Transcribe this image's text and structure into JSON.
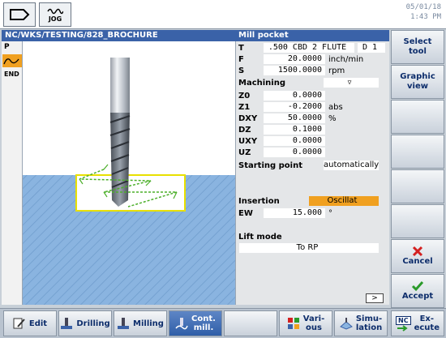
{
  "header": {
    "back_icon": "back-arrow-icon",
    "jog_label": "JOG",
    "date": "05/01/18",
    "time": "1:43 PM"
  },
  "path": "NC/WKS/TESTING/828_BROCHURE",
  "panel_title": "Mill pocket",
  "left_strip": {
    "p_label": "P",
    "end_label": "END"
  },
  "params": {
    "t": {
      "label": "T",
      "value": ".500 CBD 2 FLUTE",
      "extra": "D 1"
    },
    "f": {
      "label": "F",
      "value": "20.0000",
      "unit": "inch/min"
    },
    "s": {
      "label": "S",
      "value": "1500.0000",
      "unit": "rpm"
    },
    "machining": {
      "label": "Machining",
      "value": "▽"
    },
    "z0": {
      "label": "Z0",
      "value": "0.0000"
    },
    "z1": {
      "label": "Z1",
      "value": "-0.2000",
      "unit": "abs"
    },
    "dxy": {
      "label": "DXY",
      "value": "50.0000",
      "unit": "%"
    },
    "dz": {
      "label": "DZ",
      "value": "0.1000"
    },
    "uxy": {
      "label": "UXY",
      "value": "0.0000"
    },
    "uz": {
      "label": "UZ",
      "value": "0.0000"
    },
    "starting_point": {
      "label": "Starting point",
      "value": "automatically"
    },
    "insertion": {
      "label": "Insertion",
      "value": "Oscillat"
    },
    "ew": {
      "label": "EW",
      "value": "15.000",
      "unit": "°"
    },
    "lift_mode": {
      "label": "Lift mode",
      "value": "To RP"
    },
    "scroll_label": ">"
  },
  "right_softkeys": {
    "select_tool": "Select tool",
    "graphic_view": "Graphic view",
    "cancel": "Cancel",
    "accept": "Accept"
  },
  "bottom_softkeys": {
    "edit": "Edit",
    "drilling": "Drilling",
    "milling": "Milling",
    "cont_mill_1": "Cont.",
    "cont_mill_2": "mill.",
    "various_1": "Vari-",
    "various_2": "ous",
    "simulation_1": "Simu-",
    "simulation_2": "lation",
    "execute_1": "Ex-",
    "execute_2": "ecute",
    "nc_label": "NC"
  },
  "colors": {
    "header_blue": "#3a62a8",
    "insertion_orange": "#f0a020",
    "material_blue": "#8ab4e0",
    "workpiece_yellow": "#e8e000",
    "toolpath_green": "#4caf2a",
    "cancel_red": "#d42020",
    "accept_green": "#2a9a2a"
  }
}
